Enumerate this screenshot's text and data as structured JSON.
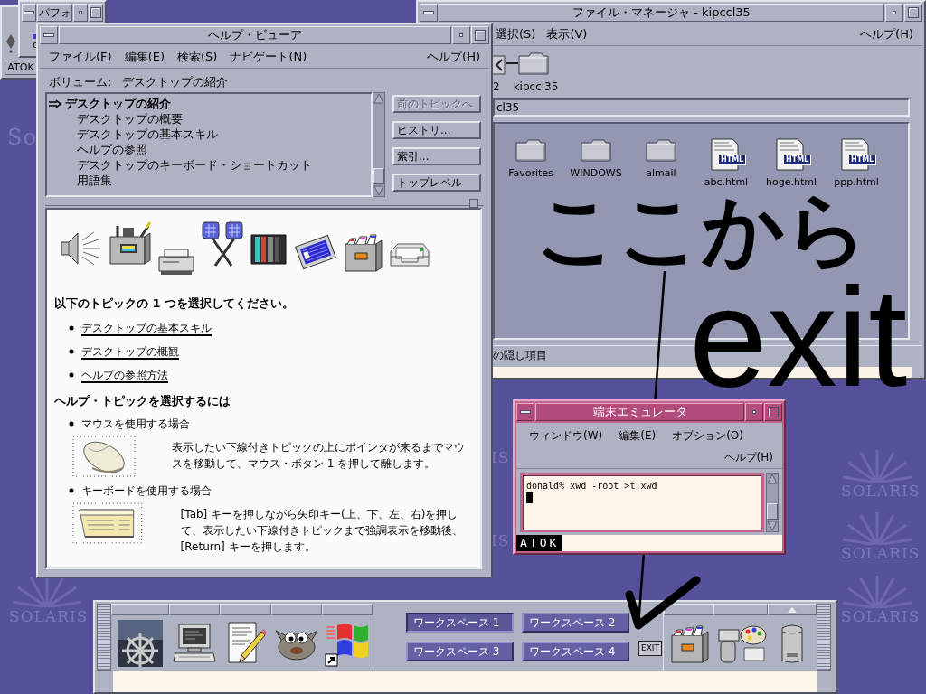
{
  "desktop": {
    "wallpaper_logos": [
      "So",
      "SOLARIS",
      "IS",
      "IS",
      "SOLARIS",
      "SOLARIS",
      "SOLARIS"
    ]
  },
  "atok_window": {
    "label": "ATOK"
  },
  "performance_window": {
    "title": "パフォ",
    "active": false,
    "text": "c"
  },
  "help_viewer": {
    "title": "ヘルプ・ビューア",
    "active": false,
    "menus": [
      "ファイル(F)",
      "編集(E)",
      "検索(S)",
      "ナビゲート(N)"
    ],
    "help_menu": "ヘルプ(H)",
    "volume_label": "ボリューム:",
    "volume": "デスクトップの紹介",
    "topics": [
      {
        "label": "デスクトップの紹介",
        "selected": true,
        "children": [
          {
            "label": "デスクトップの概要",
            "selected": false
          },
          {
            "label": "デスクトップの基本スキル",
            "selected": false
          },
          {
            "label": "ヘルプの参照",
            "selected": false
          },
          {
            "label": "デスクトップのキーボード・ショートカット",
            "selected": false
          },
          {
            "label": "用語集",
            "selected": false
          }
        ]
      }
    ],
    "buttons": [
      {
        "label": "前のトピックへ",
        "disabled": true
      },
      {
        "label": "ヒストリ...",
        "disabled": false
      },
      {
        "label": "索引...",
        "disabled": false
      },
      {
        "label": "トップレベル",
        "disabled": false
      }
    ],
    "content": {
      "heading": "以下のトピックの 1 つを選択してください。",
      "links": [
        "デスクトップの基本スキル",
        "デスクトップの概観",
        "ヘルプの参照方法"
      ],
      "section_heading": "ヘルプ・トピックを選択するには",
      "methods": [
        {
          "kind": "mouse",
          "label": "マウスを使用する場合",
          "text": "表示したい下線付きトピックの上にポインタが来るまでマウスを移動して、マウス・ボタン 1 を押して離します。"
        },
        {
          "kind": "keyboard",
          "label": "キーボードを使用する場合",
          "text": "[Tab] キーを押しながら矢印キー(上、下、左、右)を押して、表示したい下線付きトピックまで強調表示を移動後、[Return] キーを押します。"
        }
      ]
    }
  },
  "file_manager": {
    "title": "ファイル・マネージャ - kipccl35",
    "active": false,
    "menus": [
      "選択(S)",
      "表示(V)"
    ],
    "help_menu": "ヘルプ(H)",
    "path": [
      "2",
      "kipccl35"
    ],
    "location": "cl35",
    "files": [
      {
        "name": "Favorites",
        "kind": "folder"
      },
      {
        "name": "WINDOWS",
        "kind": "folder"
      },
      {
        "name": "almail",
        "kind": "folder"
      },
      {
        "name": "abc.html",
        "kind": "html",
        "badge": "HTML"
      },
      {
        "name": "hoge.html",
        "kind": "html",
        "badge": "HTML"
      },
      {
        "name": "ppp.html",
        "kind": "html",
        "badge": "HTML"
      }
    ],
    "status": "の隠し項目"
  },
  "terminal": {
    "title": "端末エミュレータ",
    "active": true,
    "menus": [
      "ウィンドウ(W)",
      "編集(E)",
      "オプション(O)"
    ],
    "help_menu": "ヘルプ(H)",
    "lines": [
      "donald% xwd -root >t.xwd"
    ],
    "input_method": "ATOK"
  },
  "front_panel": {
    "workspaces": [
      {
        "label": "ワークスペース 1",
        "selected": true
      },
      {
        "label": "ワークスペース 2",
        "selected": false
      },
      {
        "label": "ワークスペース 3",
        "selected": false
      },
      {
        "label": "ワークスペース 4",
        "selected": false
      }
    ],
    "exit_label": "EXIT"
  },
  "annotation": {
    "lines": [
      "ここから",
      "exit"
    ]
  }
}
